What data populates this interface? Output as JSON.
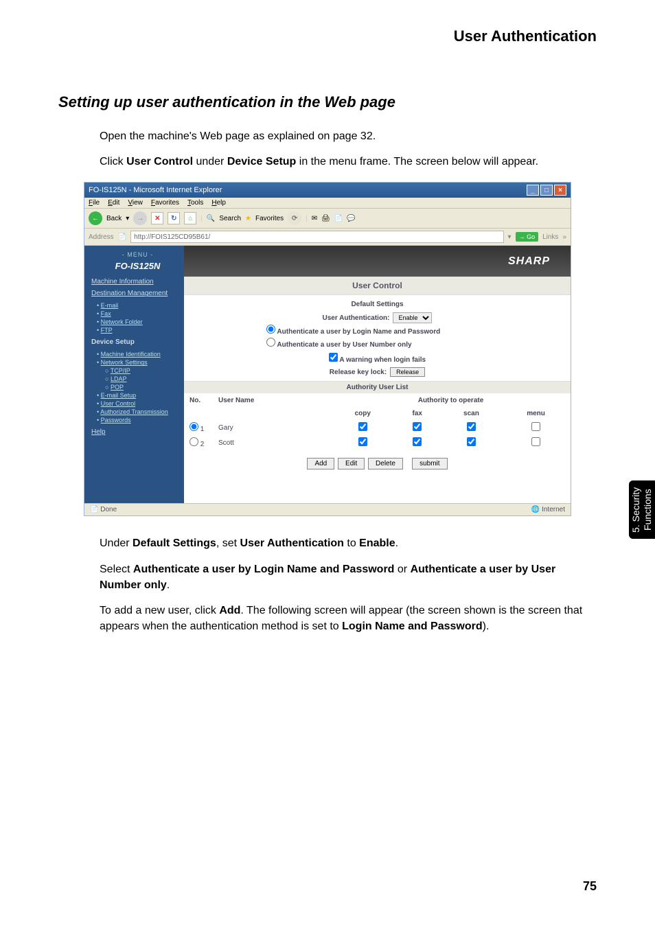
{
  "page": {
    "header": "User Authentication",
    "section_title": "Setting up user authentication in the Web page",
    "intro1": "Open the machine's Web page as explained on page 32.",
    "intro2_a": "Click ",
    "intro2_b": "User Control",
    "intro2_c": " under ",
    "intro2_d": "Device Setup",
    "intro2_e": " in the menu frame. The screen below will appear.",
    "under1_a": "Under ",
    "under1_b": "Default Settings",
    "under1_c": ", set ",
    "under1_d": "User Authentication",
    "under1_e": " to ",
    "under1_f": "Enable",
    "under1_g": ".",
    "select_a": "Select ",
    "select_b": "Authenticate a user by Login Name and Password",
    "select_c": " or ",
    "select_d": "Authenticate a user by User Number only",
    "select_e": ".",
    "add_a": "To add a new user, click ",
    "add_b": "Add",
    "add_c": ". The following screen will appear (the screen shown is the screen that appears when the authentication method is set to ",
    "add_d": "Login Name and Password",
    "add_e": ").",
    "page_number": "75",
    "side_tab": "5. Security Functions"
  },
  "browser": {
    "title": "FO-IS125N - Microsoft Internet Explorer",
    "menus": [
      "File",
      "Edit",
      "View",
      "Favorites",
      "Tools",
      "Help"
    ],
    "back_label": "Back",
    "search_label": "Search",
    "favorites_label": "Favorites",
    "address_label": "Address",
    "url": "http://FOIS125CD95B61/",
    "go_label": "Go",
    "links_label": "Links",
    "status_done": "Done",
    "status_zone": "Internet"
  },
  "sidebar": {
    "menu_label": "- MENU -",
    "model": "FO-IS125N",
    "machine_info": "Machine Information",
    "dest_mgmt": "Destination Management",
    "dest_items": [
      "E-mail",
      "Fax",
      "Network Folder",
      "FTP"
    ],
    "device_setup": "Device Setup",
    "device_items": [
      {
        "label": "Machine Identification",
        "sub": false
      },
      {
        "label": "Network Settings",
        "sub": false
      },
      {
        "label": "TCP/IP",
        "sub": true
      },
      {
        "label": "LDAP",
        "sub": true
      },
      {
        "label": "POP",
        "sub": true
      },
      {
        "label": "E-mail Setup",
        "sub": false
      },
      {
        "label": "User Control",
        "sub": false
      },
      {
        "label": "Authorized Transmission",
        "sub": false
      },
      {
        "label": "Passwords",
        "sub": false
      }
    ],
    "help": "Help"
  },
  "main": {
    "logo": "SHARP",
    "panel_title": "User Control",
    "default_settings": "Default Settings",
    "ua_label": "User Authentication:",
    "ua_value": "Enable",
    "radio1": "Authenticate a user by Login Name and Password",
    "radio2": "Authenticate a user by User Number only",
    "warn_label": "A warning when login fails",
    "release_label": "Release key lock:",
    "release_btn": "Release",
    "authlist": "Authority User List",
    "cols": {
      "no": "No.",
      "name": "User Name",
      "auth": "Authority to operate",
      "copy": "copy",
      "fax": "fax",
      "scan": "scan",
      "menu": "menu"
    },
    "rows": [
      {
        "no": "1",
        "name": "Gary",
        "copy": true,
        "fax": true,
        "scan": true,
        "menu": false
      },
      {
        "no": "2",
        "name": "Scott",
        "copy": true,
        "fax": true,
        "scan": true,
        "menu": false
      }
    ],
    "buttons": [
      "Add",
      "Edit",
      "Delete",
      "submit"
    ]
  }
}
